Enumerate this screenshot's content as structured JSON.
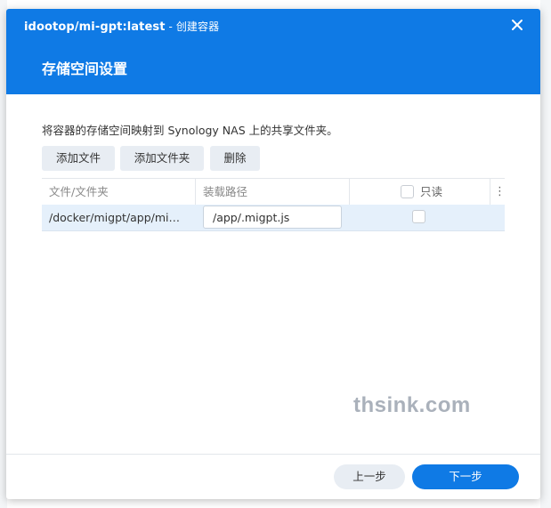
{
  "window": {
    "title": "idootop/mi-gpt:latest",
    "title_suffix": " - 创建容器",
    "close_icon": "close-icon"
  },
  "step_title": "存储空间设置",
  "description": "将容器的存储空间映射到 Synology NAS 上的共享文件夹。",
  "toolbar": {
    "add_file": "添加文件",
    "add_folder": "添加文件夹",
    "delete": "删除"
  },
  "table": {
    "columns": {
      "file_folder": "文件/文件夹",
      "mount_path": "装载路径",
      "read_only": "只读"
    },
    "rows": [
      {
        "file_folder": "/docker/migpt/app/mi…",
        "mount_path": "/app/.migpt.js",
        "read_only": false
      }
    ]
  },
  "watermark": "thsink.com",
  "footer": {
    "prev": "上一步",
    "next": "下一步"
  },
  "colors": {
    "header": "#0f7ae5",
    "primary_button": "#0f7ae5",
    "selected_row": "#e5f0fb"
  }
}
